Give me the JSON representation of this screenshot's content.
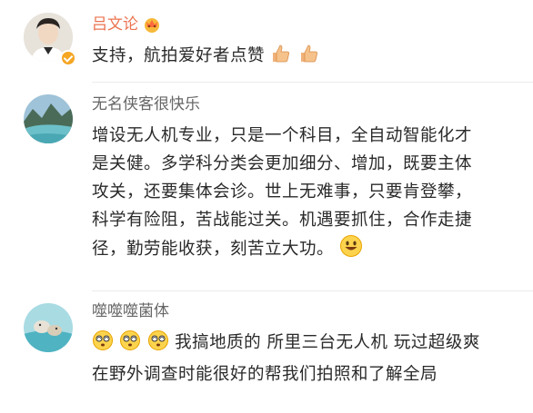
{
  "comments": [
    {
      "username": "吕文论",
      "text": "支持，航拍爱好者点赞",
      "badge_icon": "crown-badge-icon",
      "verified_icon": "verified-badge-icon",
      "trailing_emoji": [
        "thumbs-up-icon",
        "thumbs-up-icon"
      ]
    },
    {
      "username": "无名侠客很快乐",
      "text": "增设无人机专业，只是一个科目，全自动智能化才是关健。多学科分类会更加细分、增加，既要主体攻关，还要集体会诊。世上无难事，只要肯登攀，科学有险阻，苦战能过关。机遇要抓住，合作走捷径，勤劳能收获，刻苦立大功。",
      "trailing_emoji": [
        "smile-emoji-icon"
      ]
    },
    {
      "username": "噬噬噬菌体",
      "leading_emoji": [
        "dizzy-face-icon",
        "dizzy-face-icon",
        "dizzy-face-icon"
      ],
      "text": "我搞地质的 所里三台无人机 玩过超级爽 在野外调查时能很好的帮我们拍照和了解全局"
    }
  ],
  "colors": {
    "verified_name": "#eb7350",
    "normal_name": "#666666",
    "body_text": "#2a2a2a",
    "badge": "#f5a623"
  }
}
